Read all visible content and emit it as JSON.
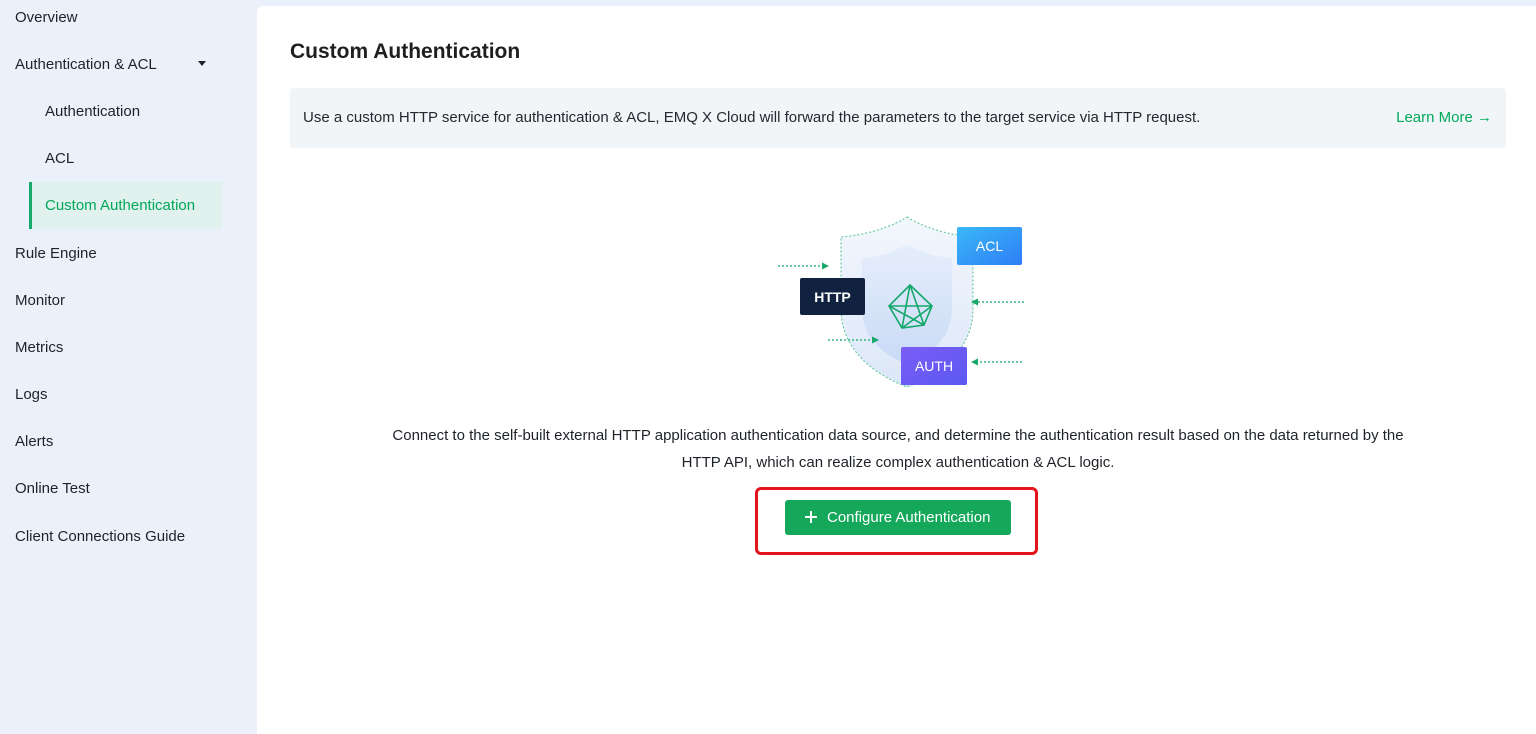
{
  "sidebar": {
    "overview": "Overview",
    "auth_group": "Authentication & ACL",
    "authentication": "Authentication",
    "acl": "ACL",
    "custom_authentication": "Custom Authentication",
    "rule_engine": "Rule Engine",
    "monitor": "Monitor",
    "metrics": "Metrics",
    "logs": "Logs",
    "alerts": "Alerts",
    "online_test": "Online Test",
    "client_connections_guide": "Client Connections Guide"
  },
  "main": {
    "title": "Custom Authentication",
    "info": "Use a custom HTTP service for authentication & ACL, EMQ X Cloud will forward the parameters to the target service via HTTP request.",
    "learn_more": "Learn More →",
    "illustration": {
      "http_label": "HTTP",
      "acl_label": "ACL",
      "auth_label": "AUTH"
    },
    "description": "Connect to the self-built external HTTP application authentication data source, and determine the authentication result based on the data returned by the HTTP API, which can realize complex authentication & ACL logic.",
    "configure_button": "Configure Authentication"
  },
  "colors": {
    "accent_green": "#15a85a",
    "sidebar_bg": "#eaf1fa",
    "highlight_red": "#e3141b"
  }
}
